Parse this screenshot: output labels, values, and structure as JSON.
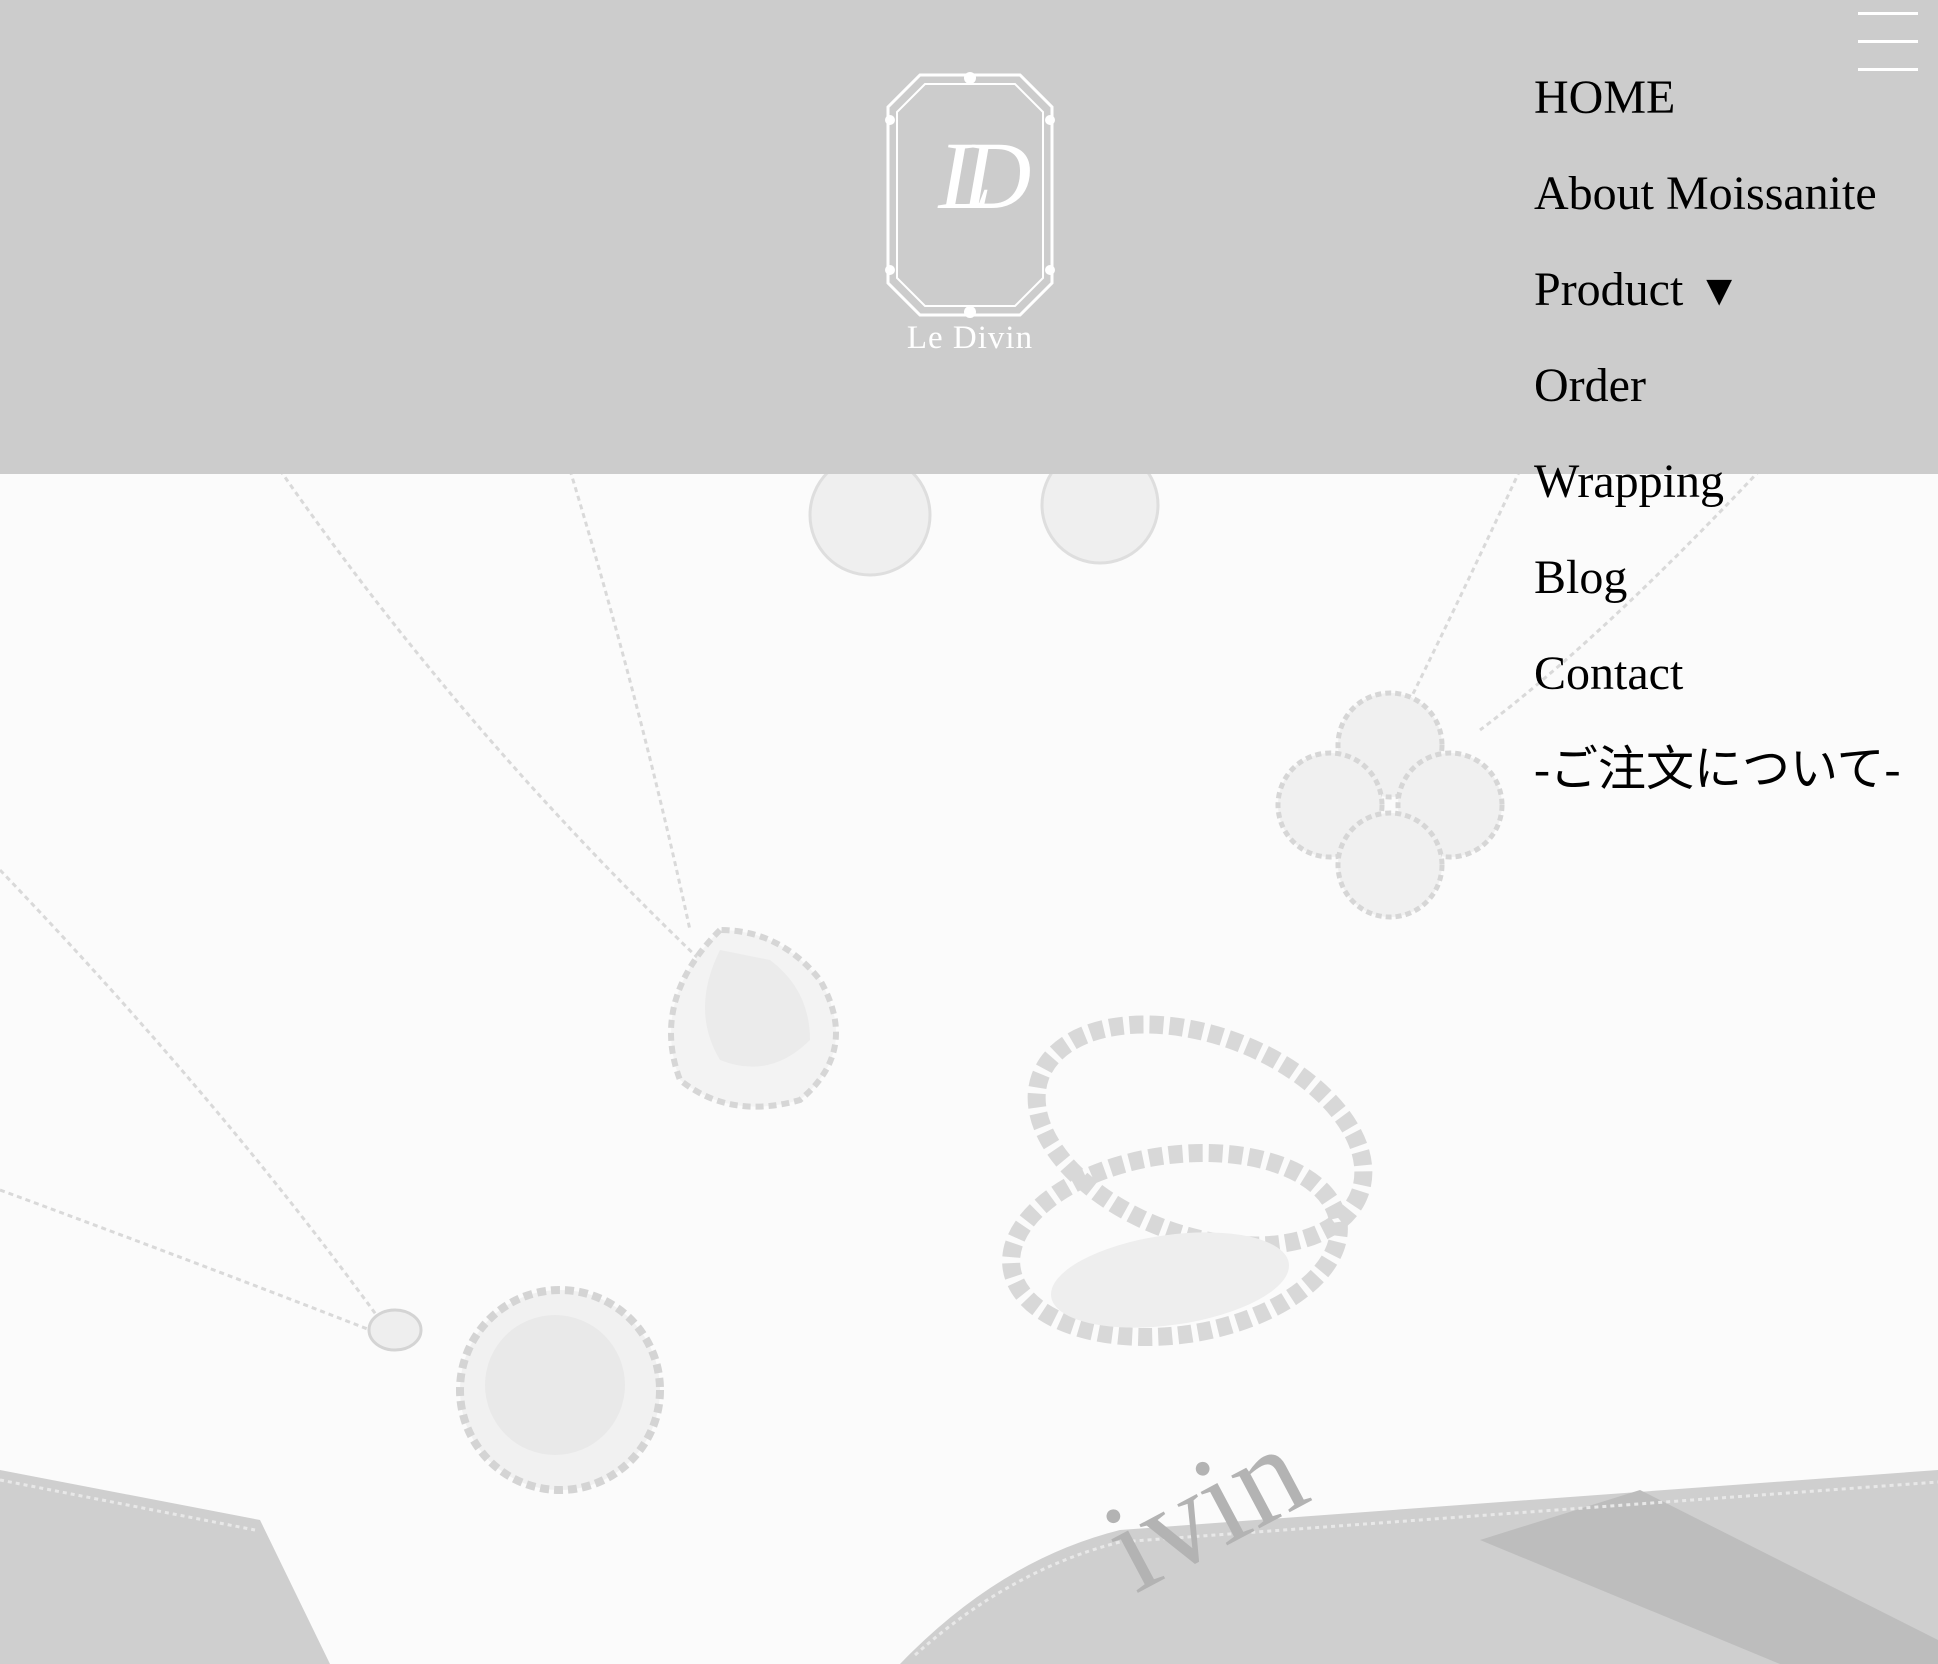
{
  "brand": {
    "monogram": "LD",
    "name": "Le Divin"
  },
  "nav": {
    "items": [
      {
        "label": "HOME"
      },
      {
        "label": "About Moissanite"
      },
      {
        "label": "Product",
        "dropdown_indicator": "▼"
      },
      {
        "label": "Order"
      },
      {
        "label": "Wrapping"
      },
      {
        "label": "Blog"
      },
      {
        "label": "Contact"
      },
      {
        "label": "-ご注文について-"
      }
    ]
  },
  "hero": {
    "ribbon_text": "ivin"
  },
  "colors": {
    "header_bg": "#cccccc",
    "page_bg": "#fbfbfb",
    "nav_text": "#000000",
    "logo": "#ffffff"
  },
  "icons": {
    "menu": "hamburger-menu-icon"
  }
}
